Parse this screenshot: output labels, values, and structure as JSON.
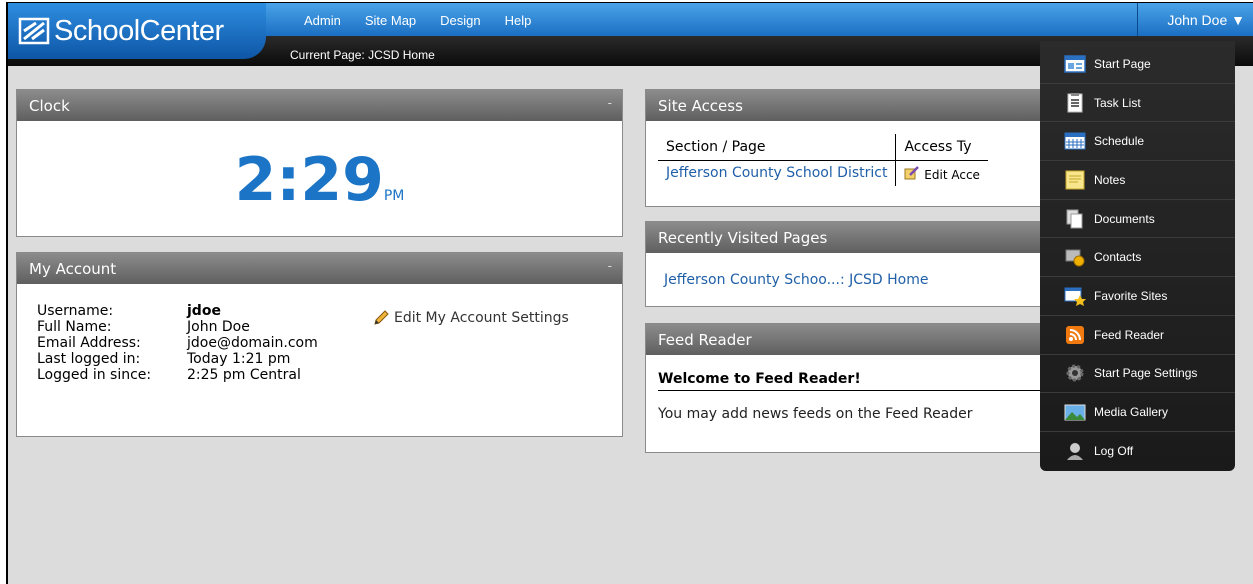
{
  "app": {
    "logo_text": "SchoolCenter",
    "nav": [
      "Admin",
      "Site Map",
      "Design",
      "Help"
    ],
    "user_label": "John Doe ▼",
    "current_page_label": "Current Page:",
    "current_page_value": "JCSD Home"
  },
  "colors": {
    "accent": "#1b74c6",
    "bar_dark": "#111111"
  },
  "clock": {
    "title": "Clock",
    "time": "2:29",
    "ampm": "PM",
    "minimize": "-"
  },
  "account": {
    "title": "My Account",
    "minimize": "-",
    "rows": [
      {
        "label": "Username:",
        "value": "jdoe"
      },
      {
        "label": "Full Name:",
        "value": "John Doe"
      },
      {
        "label": "Email Address:",
        "value": "jdoe@domain.com"
      },
      {
        "label": "Last logged in:",
        "value": "Today 1:21 pm"
      },
      {
        "label": "Logged in since:",
        "value": "2:25 pm Central"
      }
    ],
    "edit_label": "Edit My Account Settings"
  },
  "site_access": {
    "title": "Site Access",
    "col1": "Section / Page",
    "col2": "Access Ty",
    "row_page": "Jefferson County School District",
    "row_access": "Edit Acce"
  },
  "recent": {
    "title": "Recently Visited Pages",
    "item": "Jefferson County Schoo...: JCSD Home"
  },
  "feed": {
    "title": "Feed Reader",
    "welcome": "Welcome to Feed Reader!",
    "text": "You may add news feeds on the Feed Reader"
  },
  "menu": [
    {
      "label": "Start Page",
      "icon": "start-page-icon"
    },
    {
      "label": "Task List",
      "icon": "task-list-icon"
    },
    {
      "label": "Schedule",
      "icon": "schedule-icon"
    },
    {
      "label": "Notes",
      "icon": "notes-icon"
    },
    {
      "label": "Documents",
      "icon": "documents-icon"
    },
    {
      "label": "Contacts",
      "icon": "contacts-icon"
    },
    {
      "label": "Favorite Sites",
      "icon": "favorite-sites-icon"
    },
    {
      "label": "Feed Reader",
      "icon": "rss-icon"
    },
    {
      "label": "Start Page Settings",
      "icon": "gear-icon"
    },
    {
      "label": "Media Gallery",
      "icon": "media-gallery-icon"
    },
    {
      "label": "Log Off",
      "icon": "log-off-icon"
    }
  ]
}
